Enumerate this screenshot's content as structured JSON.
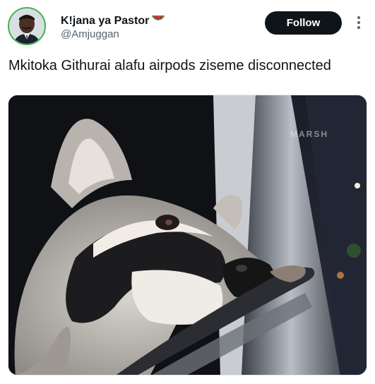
{
  "author": {
    "display_name": "K!jana ya Pastor",
    "handle": "@Amjuggan",
    "badge_icon": "watermelon-icon"
  },
  "actions": {
    "follow_label": "Follow",
    "more_icon": "more-vertical-icon"
  },
  "tweet": {
    "text": "Mkitoka Githurai alafu airpods ziseme disconnected"
  },
  "media": {
    "watermark": "MARSH"
  },
  "colors": {
    "follow_bg": "#0f1419",
    "avatar_ring": "#3fb24a",
    "handle_gray": "#536471"
  }
}
